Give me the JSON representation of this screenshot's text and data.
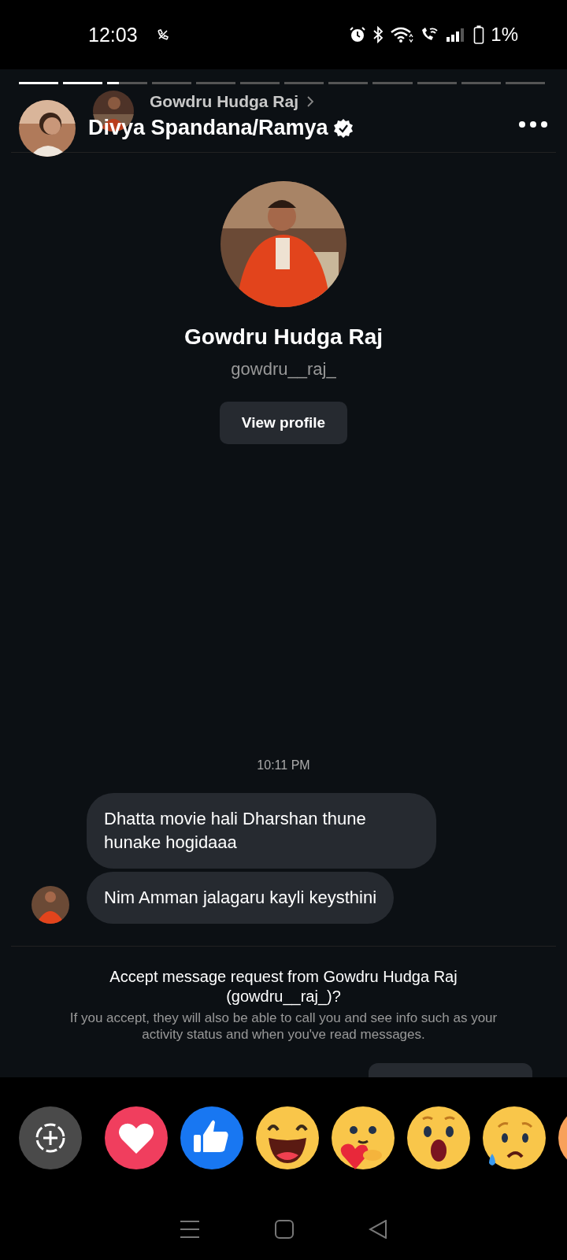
{
  "status_bar": {
    "time": "12:03",
    "battery": "1%"
  },
  "story_progress": [
    {
      "seen": true
    },
    {
      "seen": true
    },
    {
      "seen": false,
      "level": 0.3
    },
    {
      "seen": false
    },
    {
      "seen": false
    },
    {
      "seen": false
    },
    {
      "seen": false
    },
    {
      "seen": false
    },
    {
      "seen": false
    },
    {
      "seen": false
    },
    {
      "seen": false
    },
    {
      "seen": false
    }
  ],
  "header": {
    "replying_to": "Gowdru Hudga Raj",
    "story_owner": "Divya Spandana/Ramya",
    "verified": true
  },
  "profile": {
    "name": "Gowdru Hudga Raj",
    "username": "gowdru__raj_",
    "button": "View profile"
  },
  "chat": {
    "timestamp": "10:11 PM",
    "messages": [
      {
        "text": "Dhatta movie hali Dharshan thune hunake hogidaaa"
      },
      {
        "text": "Nim Amman jalagaru kayli keysthini"
      }
    ]
  },
  "request": {
    "title": "Accept message request from Gowdru Hudga Raj (gowdru__raj_)?",
    "note": "If you accept, they will also be able to call you and see info such as your activity status and when you've read messages."
  }
}
